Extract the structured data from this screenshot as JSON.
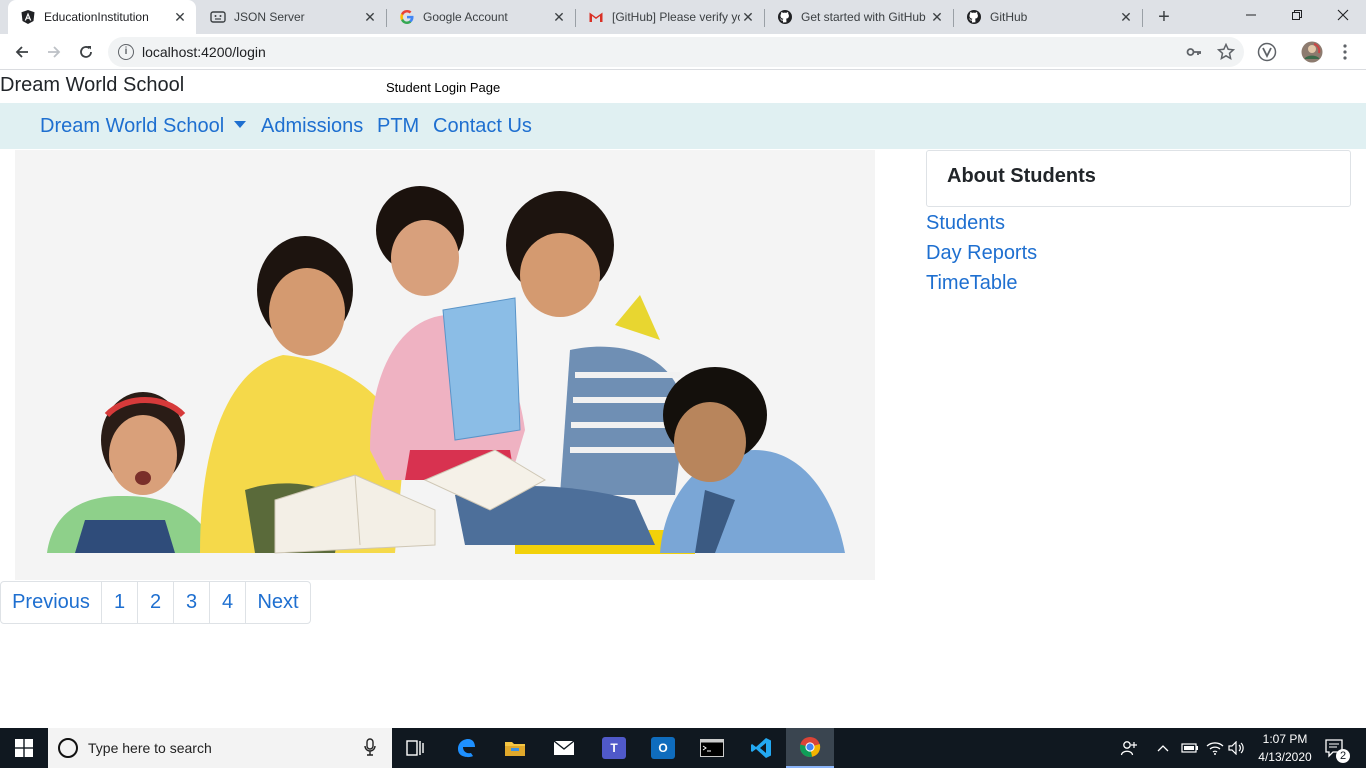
{
  "browser": {
    "tabs": [
      {
        "title": "EducationInstitution",
        "icon": "angular-icon"
      },
      {
        "title": "JSON Server",
        "icon": "json-server-icon"
      },
      {
        "title": "Google Account",
        "icon": "google-icon"
      },
      {
        "title": "[GitHub] Please verify yo",
        "icon": "gmail-icon"
      },
      {
        "title": "Get started with GitHub",
        "icon": "github-icon"
      },
      {
        "title": "GitHub",
        "icon": "github-icon"
      }
    ],
    "url": "localhost:4200/login",
    "colors": {
      "tabstrip": "#dee1e6",
      "omnibox": "#f1f3f4"
    }
  },
  "page": {
    "brand": "Dream World School",
    "heading": "Student Login Page",
    "nav": {
      "dropdown_label": "Dream World School",
      "links": [
        "Admissions",
        "PTM",
        "Contact Us"
      ]
    },
    "hero_image_alt": "",
    "sidebar": {
      "card_title": "About Students",
      "links": [
        "Students",
        "Day Reports",
        "TimeTable"
      ]
    },
    "pagination": {
      "previous": "Previous",
      "pages": [
        "1",
        "2",
        "3",
        "4"
      ],
      "next": "Next"
    },
    "colors": {
      "navbar": "#e0f0f2",
      "link": "#1e6fd0",
      "hero_bg": "#f4f4f4"
    }
  },
  "taskbar": {
    "search_placeholder": "Type here to search",
    "time": "1:07 PM",
    "date": "4/13/2020",
    "notification_count": "2",
    "pinned": [
      "task-view-icon",
      "edge-icon",
      "file-explorer-icon",
      "mail-icon",
      "teams-icon",
      "outlook-icon",
      "terminal-icon",
      "vscode-icon",
      "chrome-icon"
    ]
  }
}
